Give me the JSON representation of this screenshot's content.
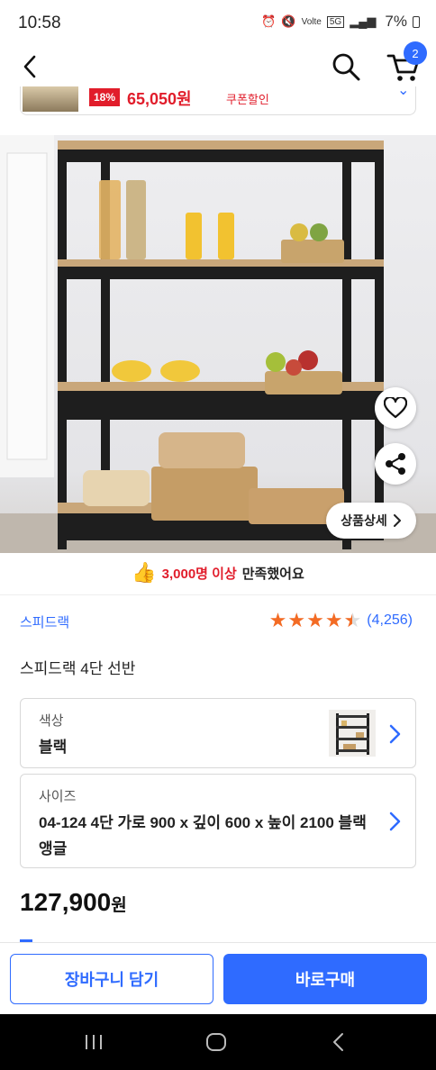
{
  "status_bar": {
    "time": "10:58",
    "network_label": "Volte",
    "network_type": "5G",
    "battery": "7%"
  },
  "nav": {
    "cart_count": "2"
  },
  "coupon_strip": {
    "discount_rate": "18%",
    "coupon_price": "65,050원",
    "coupon_label": "쿠폰할인"
  },
  "product_image": {
    "detail_button_label": "상품상세"
  },
  "satisfaction": {
    "highlight": "3,000명 이상",
    "suffix": "만족했어요"
  },
  "product": {
    "brand": "스피드랙",
    "rating_value": 4.5,
    "review_count": "(4,256)",
    "title": "스피드랙 4단 선반",
    "price_amount": "127,900",
    "price_unit": "원"
  },
  "options": {
    "color": {
      "label": "색상",
      "value": "블랙"
    },
    "size": {
      "label": "사이즈",
      "value": "04-124 4단 가로 900 x 깊이 600 x 높이 2100 블랙앵글"
    }
  },
  "actions": {
    "add_to_cart": "장바구니 담기",
    "buy_now": "바로구매"
  },
  "colors": {
    "accent_blue": "#2f6bff",
    "sale_red": "#e11d2b",
    "star_orange": "#f36b24",
    "thumb_yellow": "#f5a623"
  }
}
